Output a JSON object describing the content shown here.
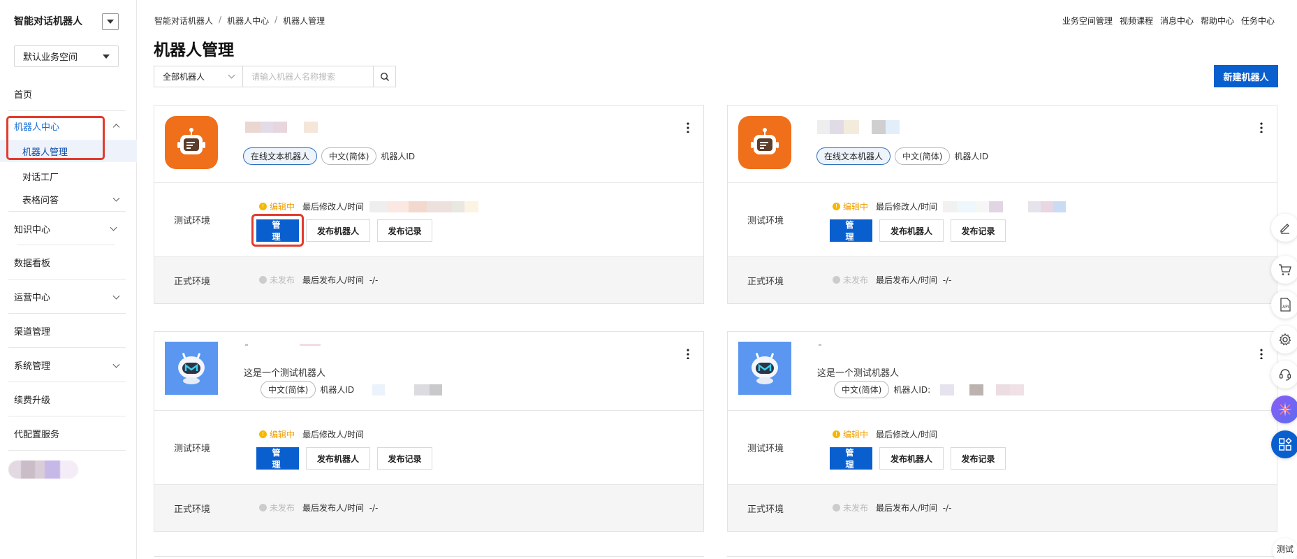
{
  "app": {
    "title": "智能对话机器人"
  },
  "space": {
    "selected": "默认业务空间"
  },
  "sidebar": {
    "items": [
      {
        "label": "首页"
      },
      {
        "label": "机器人中心"
      },
      {
        "label": "机器人管理"
      },
      {
        "label": "对话工厂"
      },
      {
        "label": "表格问答"
      },
      {
        "label": "知识中心"
      },
      {
        "label": "数据看板"
      },
      {
        "label": "运营中心"
      },
      {
        "label": "渠道管理"
      },
      {
        "label": "系统管理"
      },
      {
        "label": "续费升级"
      },
      {
        "label": "代配置服务"
      }
    ]
  },
  "breadcrumb": [
    "智能对话机器人",
    "机器人中心",
    "机器人管理"
  ],
  "header": {
    "title": "机器人管理",
    "links": [
      "业务空间管理",
      "视频课程",
      "消息中心",
      "帮助中心",
      "任务中心"
    ]
  },
  "filter": {
    "type_selected": "全部机器人",
    "search_placeholder": "请输入机器人名称搜索"
  },
  "toolbar": {
    "new_label": "新建机器人"
  },
  "colors": {
    "primary": "#0a5fcf",
    "highlight": "#e23b2e",
    "warning": "#f5b700",
    "orange_avatar": "#f06f1b",
    "blue_avatar": "#5b97f0"
  },
  "labels": {
    "test_env": "测试环境",
    "prod_env": "正式环境",
    "editing": "编辑中",
    "unpublished": "未发布",
    "last_modified": "最后修改人/时间",
    "last_published": "最后发布人/时间",
    "last_published_value": "-/-",
    "manage": "管 理",
    "publish": "发布机器人",
    "records": "发布记录",
    "robot_id": "机器人ID"
  },
  "cards": [
    {
      "type_tag": "在线文本机器人",
      "lang_tag": "中文(简体)",
      "id_label": "机器人ID",
      "avatar_icon": "robot-icon",
      "description": ""
    },
    {
      "type_tag": "在线文本机器人",
      "lang_tag": "中文(简体)",
      "id_label": "机器人ID",
      "avatar_icon": "robot-icon",
      "description": ""
    },
    {
      "type_tag": "",
      "lang_tag": "中文(简体)",
      "id_label": "机器人ID",
      "avatar_icon": "robot-head-icon",
      "description": "这是一个测试机器人"
    },
    {
      "type_tag": "",
      "lang_tag": "中文(简体)",
      "id_label": "机器人ID:",
      "avatar_icon": "robot-head-icon",
      "description": "这是一个测试机器人"
    }
  ],
  "rail": {
    "bottom_label": "测试"
  }
}
